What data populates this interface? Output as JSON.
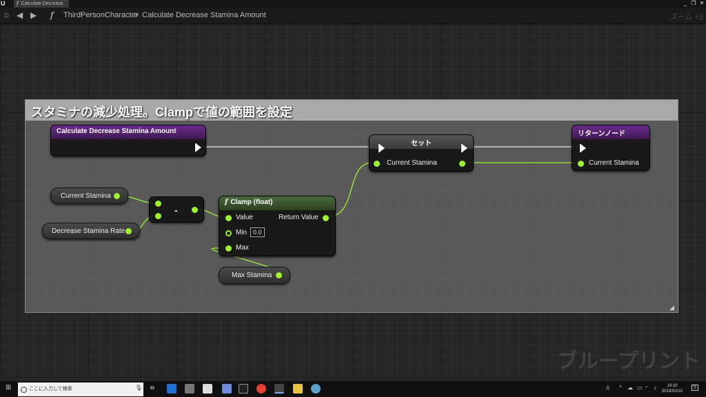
{
  "window": {
    "tab_title": "Calculate Decrease",
    "minimize": "_",
    "restore": "❐",
    "close": "✕"
  },
  "nav": {
    "class_name": "ThirdPersonCharacter",
    "separator": ">",
    "function_name": "Calculate Decrease Stamina Amount",
    "zoom": "ズーム +3"
  },
  "comment": {
    "title": "スタミナの減少処理。Clampで値の範囲を設定"
  },
  "nodes": {
    "entry": {
      "title": "Calculate Decrease Stamina Amount"
    },
    "set": {
      "title": "セット",
      "pin_current_stamina": "Current Stamina"
    },
    "return": {
      "title": "リターンノード",
      "pin_current_stamina": "Current Stamina"
    },
    "current_stamina": {
      "label": "Current Stamina"
    },
    "decrease_rate": {
      "label": "Decrease Stamina Rate"
    },
    "subtract": {
      "label": "-"
    },
    "clamp": {
      "title": "Clamp (float)",
      "value": "Value",
      "min": "Min",
      "min_default": "0.0",
      "max": "Max",
      "return_value": "Return Value"
    },
    "max_stamina": {
      "label": "Max Stamina"
    }
  },
  "watermark": "ブループリント",
  "taskbar": {
    "search_placeholder": "ここに入力して検索",
    "time": "14:10",
    "date": "2019/02/10",
    "notification_count": "5"
  },
  "colors": {
    "float_pin": "#9ef230",
    "function_header": "#6a2a8a",
    "comment_header": "#a9a9a9"
  }
}
